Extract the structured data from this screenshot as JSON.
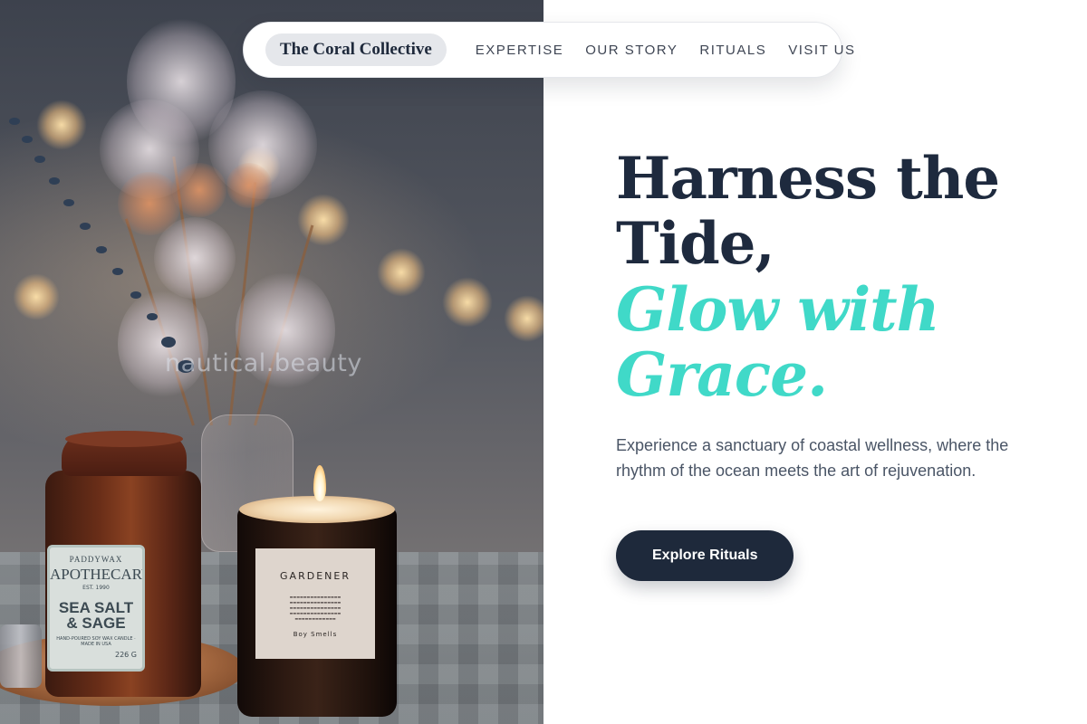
{
  "nav": {
    "brand": "The Coral Collective",
    "links": [
      {
        "label": "EXPERTISE"
      },
      {
        "label": "OUR STORY"
      },
      {
        "label": "RITUALS"
      },
      {
        "label": "VISIT US"
      }
    ]
  },
  "hero": {
    "headline_line1": "Harness the",
    "headline_line2": "Tide,",
    "accent_line1": "Glow with",
    "accent_line2": "Grace.",
    "lede": "Experience a sanctuary of coastal wellness, where the rhythm of the ocean meets the art of rejuvenation.",
    "cta_label": "Explore Rituals"
  },
  "photo": {
    "watermark": "nautical.beauty",
    "jar_label": {
      "brand": "PADDYWAX",
      "title": "APOTHECARY",
      "est": "EST. 1990",
      "scent_line1": "SEA SALT",
      "scent_line2": "& SAGE",
      "fine_print": "HAND-POURED SOY WAX CANDLE · MADE IN USA",
      "weight": "226 G"
    },
    "candle_label": {
      "title": "GARDENER",
      "fine_print": "...",
      "maker": "Boy Smells"
    }
  },
  "colors": {
    "navy": "#1e293b",
    "accent": "#40d9c8",
    "body_text": "#4a5566",
    "pill_bg": "#e5e7eb"
  }
}
